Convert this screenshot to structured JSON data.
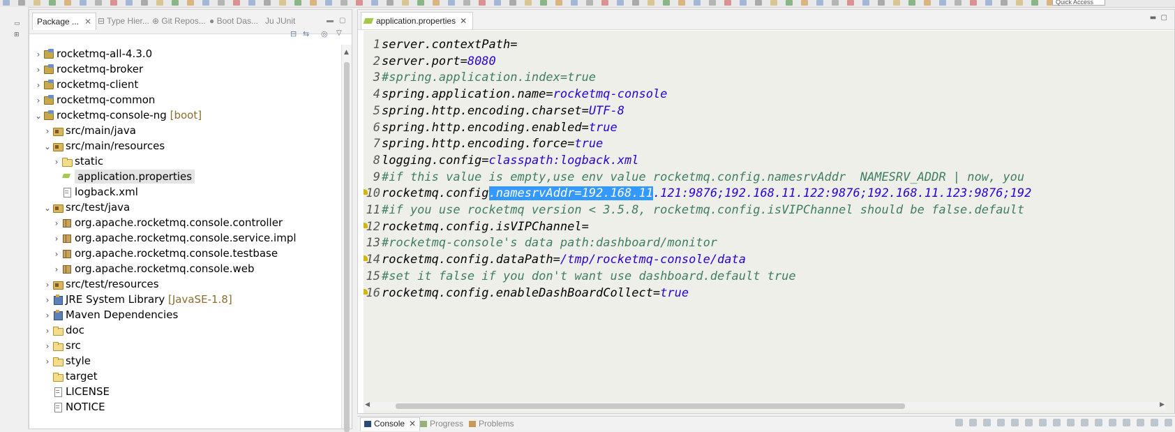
{
  "toolbar": {
    "quick_access_placeholder": "Quick Access"
  },
  "explorer": {
    "tabs": [
      {
        "label": "Package ...",
        "active": true
      },
      {
        "label": "Type Hier..."
      },
      {
        "label": "Git Repos..."
      },
      {
        "label": "Boot Das..."
      },
      {
        "label": "JUnit"
      }
    ],
    "tree": [
      {
        "label": "rocketmq-all-4.3.0",
        "icon": "project-icon",
        "decoration": ""
      },
      {
        "label": "rocketmq-broker",
        "icon": "project-icon",
        "decoration": ""
      },
      {
        "label": "rocketmq-client",
        "icon": "project-icon",
        "decoration": ""
      },
      {
        "label": "rocketmq-common",
        "icon": "project-icon",
        "decoration": ""
      },
      {
        "label": "rocketmq-console-ng",
        "icon": "project-icon",
        "decoration": " [boot]"
      },
      {
        "label": "src/main/java",
        "icon": "source-folder-icon",
        "decoration": ""
      },
      {
        "label": "src/main/resources",
        "icon": "source-folder-icon",
        "decoration": ""
      },
      {
        "label": "static",
        "icon": "folder-icon",
        "decoration": ""
      },
      {
        "label": "application.properties",
        "icon": "properties-file-icon",
        "decoration": ""
      },
      {
        "label": "logback.xml",
        "icon": "xml-file-icon",
        "decoration": ""
      },
      {
        "label": "src/test/java",
        "icon": "source-folder-icon",
        "decoration": ""
      },
      {
        "label": "org.apache.rocketmq.console.controller",
        "icon": "package-icon",
        "decoration": ""
      },
      {
        "label": "org.apache.rocketmq.console.service.impl",
        "icon": "package-icon",
        "decoration": ""
      },
      {
        "label": "org.apache.rocketmq.console.testbase",
        "icon": "package-icon",
        "decoration": ""
      },
      {
        "label": "org.apache.rocketmq.console.web",
        "icon": "package-icon",
        "decoration": ""
      },
      {
        "label": "src/test/resources",
        "icon": "source-folder-icon",
        "decoration": ""
      },
      {
        "label": "JRE System Library",
        "icon": "library-icon",
        "decoration": " [JavaSE-1.8]"
      },
      {
        "label": "Maven Dependencies",
        "icon": "library-icon",
        "decoration": ""
      },
      {
        "label": "doc",
        "icon": "folder-icon",
        "decoration": ""
      },
      {
        "label": "src",
        "icon": "folder-icon",
        "decoration": ""
      },
      {
        "label": "style",
        "icon": "folder-icon",
        "decoration": ""
      },
      {
        "label": "target",
        "icon": "folder-icon",
        "decoration": ""
      },
      {
        "label": "LICENSE",
        "icon": "file-icon",
        "decoration": ""
      },
      {
        "label": "NOTICE",
        "icon": "file-icon",
        "decoration": ""
      }
    ]
  },
  "editor": {
    "tab_label": "application.properties",
    "lines": [
      {
        "num": "1",
        "parts": [
          {
            "t": "server.contextPath=",
            "c": "k"
          }
        ]
      },
      {
        "num": "2",
        "parts": [
          {
            "t": "server.port=",
            "c": "k"
          },
          {
            "t": "8080",
            "c": "v"
          }
        ]
      },
      {
        "num": "3",
        "parts": [
          {
            "t": "#spring.application.index=true",
            "c": "c"
          }
        ]
      },
      {
        "num": "4",
        "parts": [
          {
            "t": "spring.application.name=",
            "c": "k"
          },
          {
            "t": "rocketmq-console",
            "c": "v"
          }
        ]
      },
      {
        "num": "5",
        "parts": [
          {
            "t": "spring.http.encoding.charset=",
            "c": "k"
          },
          {
            "t": "UTF-8",
            "c": "v"
          }
        ]
      },
      {
        "num": "6",
        "parts": [
          {
            "t": "spring.http.encoding.enabled=",
            "c": "k"
          },
          {
            "t": "true",
            "c": "v"
          }
        ]
      },
      {
        "num": "7",
        "parts": [
          {
            "t": "spring.http.encoding.force=",
            "c": "k"
          },
          {
            "t": "true",
            "c": "v"
          }
        ]
      },
      {
        "num": "8",
        "parts": [
          {
            "t": "logging.config=",
            "c": "k"
          },
          {
            "t": "classpath:logback.xml",
            "c": "v"
          }
        ]
      },
      {
        "num": "9",
        "parts": [
          {
            "t": "#if this value is empty,use env value rocketmq.config.namesrvAddr  NAMESRV_ADDR | now, you",
            "c": "c"
          }
        ]
      },
      {
        "num": "10",
        "warn": true,
        "parts": [
          {
            "t": "rocketmq.config",
            "c": "k"
          },
          {
            "t": ".namesrvAddr=192.168.11",
            "c": "sel"
          },
          {
            "t": ".121:9876;192.168.11.122:9876;192.168.11.123:9876;192",
            "c": "v"
          }
        ]
      },
      {
        "num": "11",
        "parts": [
          {
            "t": "#if you use rocketmq version < 3.5.8, rocketmq.config.isVIPChannel should be false.default",
            "c": "c"
          }
        ]
      },
      {
        "num": "12",
        "warn": true,
        "parts": [
          {
            "t": "rocketmq.config.isVIPChannel=",
            "c": "k"
          }
        ]
      },
      {
        "num": "13",
        "parts": [
          {
            "t": "#rocketmq-console's data path:dashboard/monitor",
            "c": "c"
          }
        ]
      },
      {
        "num": "14",
        "warn": true,
        "parts": [
          {
            "t": "rocketmq.config.dataPath=",
            "c": "k"
          },
          {
            "t": "/tmp/rocketmq-console/data",
            "c": "v"
          }
        ]
      },
      {
        "num": "15",
        "parts": [
          {
            "t": "#set it false if you don't want use dashboard.default true",
            "c": "c"
          }
        ]
      },
      {
        "num": "16",
        "warn": true,
        "parts": [
          {
            "t": "rocketmq.config.enableDashBoardCollect=",
            "c": "k"
          },
          {
            "t": "true",
            "c": "v"
          }
        ]
      }
    ]
  },
  "bottom": {
    "tabs": [
      {
        "label": "Console",
        "active": true
      },
      {
        "label": "Progress"
      },
      {
        "label": "Problems"
      }
    ]
  }
}
